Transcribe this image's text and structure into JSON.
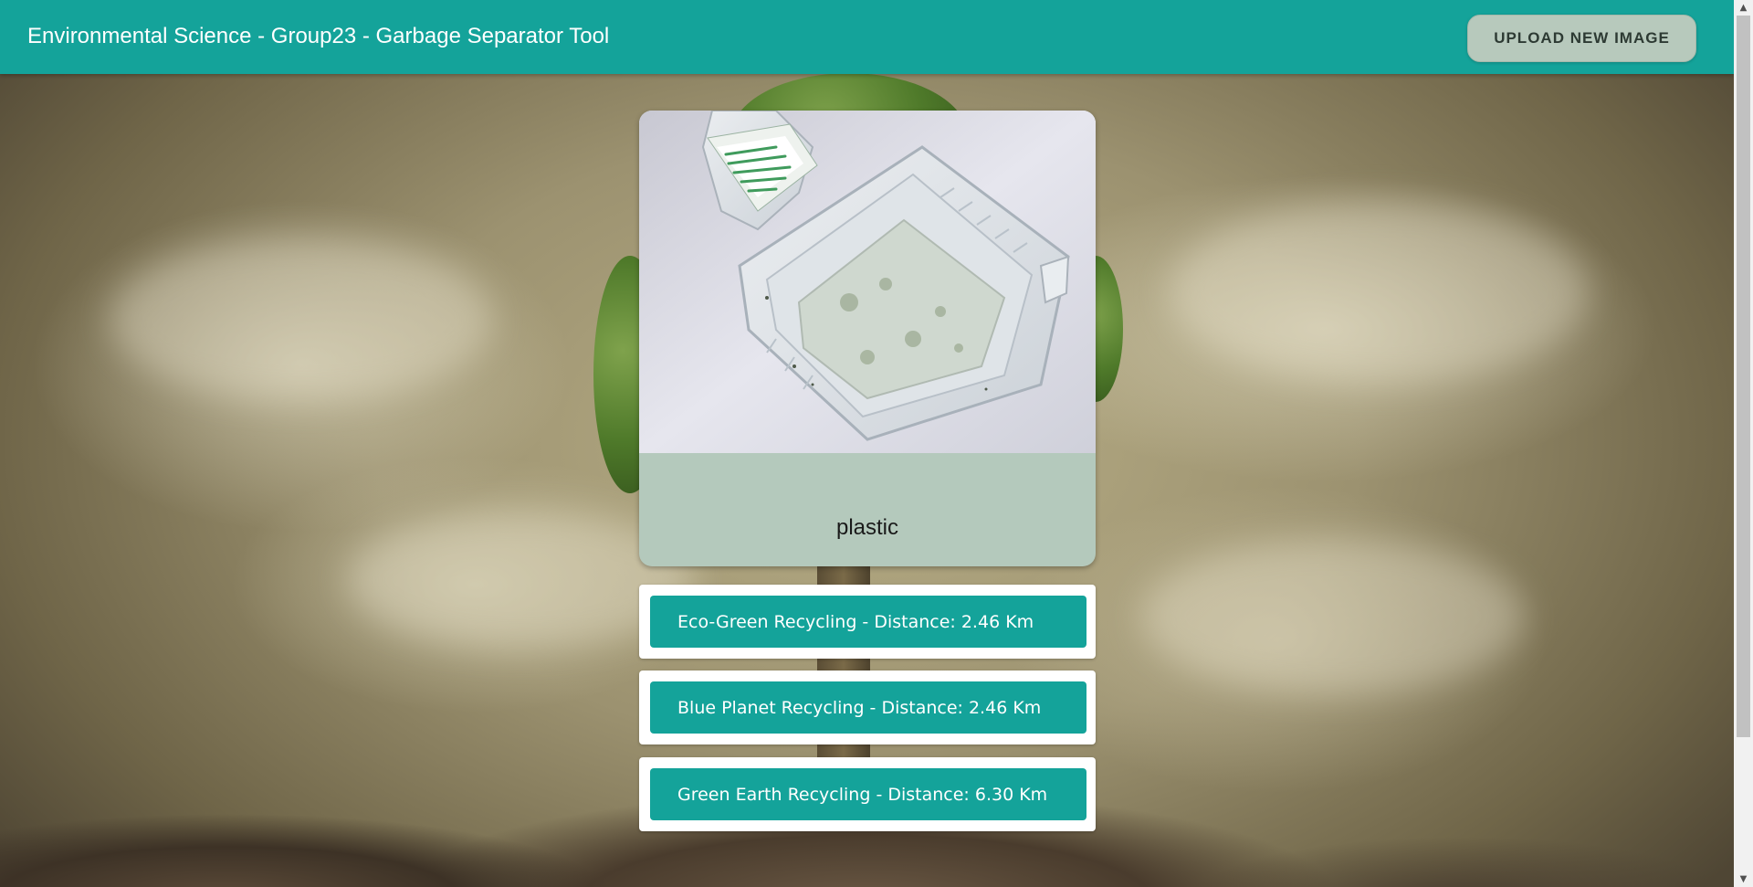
{
  "app_bar": {
    "title": "Environmental Science - Group23 - Garbage Separator Tool",
    "upload_button_label": "UPLOAD NEW IMAGE"
  },
  "result": {
    "category": "plastic",
    "photo_icon": "plastic-clamshell-container-photo"
  },
  "recyclers": [
    {
      "label": "Eco-Green Recycling - Distance: 2.46 Km"
    },
    {
      "label": "Blue Planet Recycling - Distance: 2.46 Km"
    },
    {
      "label": "Green Earth Recycling - Distance: 6.30 Km"
    }
  ],
  "colors": {
    "primary": "#14a39a",
    "upload_button_bg": "#b7c9bc",
    "result_panel_bg": "#b4c9bc"
  }
}
